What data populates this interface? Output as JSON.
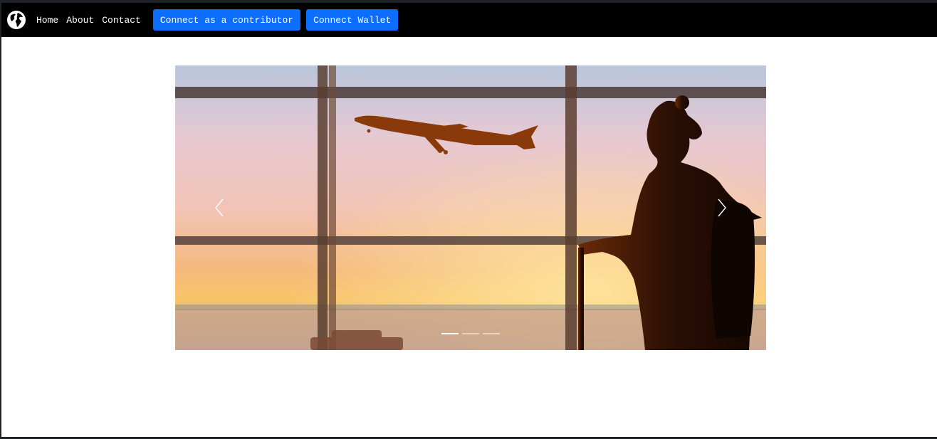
{
  "navbar": {
    "brand_icon": "globe-icon",
    "links": [
      {
        "label": "Home"
      },
      {
        "label": "About"
      },
      {
        "label": "Contact"
      }
    ],
    "buttons": {
      "contributor": "Connect as a contributor",
      "wallet": "Connect Wallet"
    }
  },
  "carousel": {
    "slide_image": "airport-traveler-airplane-sunset-photo",
    "prev_icon": "chevron-left-icon",
    "next_icon": "chevron-right-icon",
    "indicator_count": 3,
    "active_indicator": 1
  },
  "colors": {
    "navbar_bg": "#000000",
    "button_bg": "#0d6efd",
    "page_bg": "#ffffff"
  }
}
